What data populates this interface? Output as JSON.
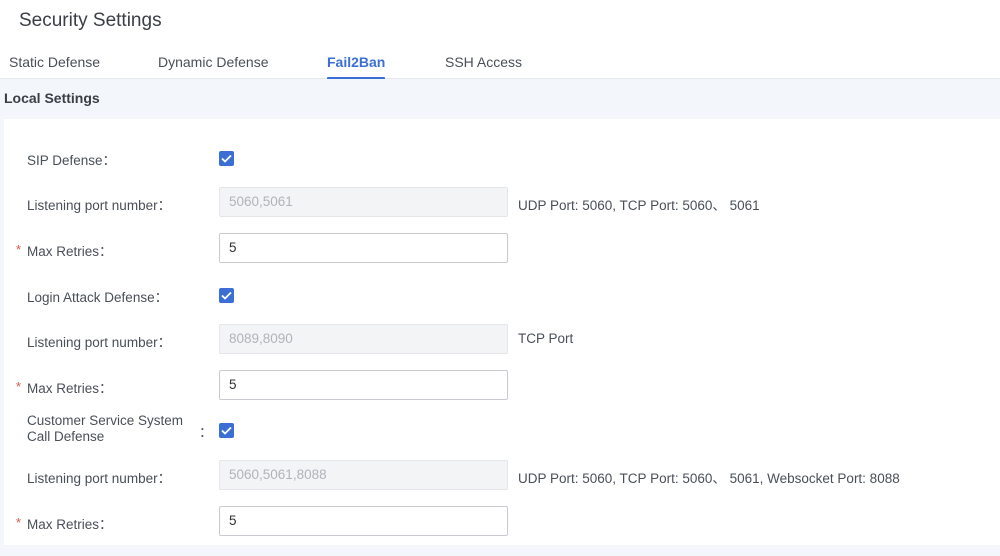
{
  "page": {
    "title": "Security Settings"
  },
  "tabs": [
    {
      "label": "Static Defense",
      "active": false
    },
    {
      "label": "Dynamic Defense",
      "active": false
    },
    {
      "label": "Fail2Ban",
      "active": true
    },
    {
      "label": "SSH Access",
      "active": false
    }
  ],
  "section": {
    "title": "Local Settings"
  },
  "form": {
    "sip": {
      "defense_label": "SIP Defense：",
      "defense_checked": true,
      "port_label": "Listening port number：",
      "port_value": "5060,5061",
      "port_hint": "UDP Port: 5060, TCP Port: 5060、 5061",
      "retries_label": "Max Retries：",
      "retries_value": "5",
      "required_mark": "*"
    },
    "login": {
      "defense_label": "Login Attack Defense：",
      "defense_checked": true,
      "port_label": "Listening port number：",
      "port_value": "8089,8090",
      "port_hint": "TCP Port",
      "retries_label": "Max Retries：",
      "retries_value": "5",
      "required_mark": "*"
    },
    "css": {
      "defense_label": "Customer Service System Call Defense",
      "defense_colon": "：",
      "defense_checked": true,
      "port_label": "Listening port number：",
      "port_value": "5060,5061,8088",
      "port_hint": "UDP Port: 5060, TCP Port: 5060、 5061, Websocket Port: 8088",
      "retries_label": "Max Retries：",
      "retries_value": "5",
      "required_mark": "*"
    }
  },
  "colors": {
    "accent": "#3b6fd6",
    "required": "#e05050",
    "section_bg": "#f3f6fa"
  }
}
